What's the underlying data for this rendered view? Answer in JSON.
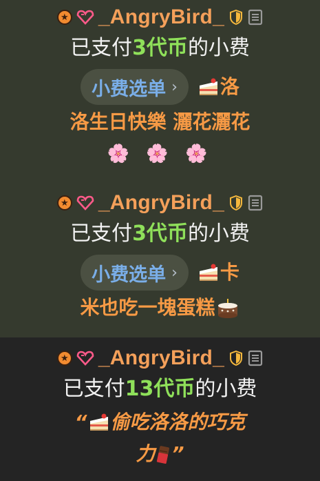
{
  "colors": {
    "card1_bg": "#353a2e",
    "card2_bg": "#242424",
    "username": "#f4a05a",
    "amount": "#8fe05a",
    "gift_text": "#f79a45",
    "menu_label": "#7aaee8"
  },
  "entries": [
    {
      "username": "_AngryBird_",
      "paid_prefix": "已支付",
      "amount": "3代币",
      "paid_suffix": "的小费",
      "menu_label": "小费选单",
      "menu_chevron": "›",
      "gift_icon": "cake-slice-icon",
      "gift_first": "洛",
      "gift_second": "洛生日快樂 灑花灑花",
      "gift_trailing": "🌸 🌸 🌸"
    },
    {
      "username": "_AngryBird_",
      "paid_prefix": "已支付",
      "amount": "3代币",
      "paid_suffix": "的小费",
      "menu_label": "小费选单",
      "menu_chevron": "›",
      "gift_icon": "cake-slice-icon",
      "gift_first": "卡",
      "gift_second": "米也吃一塊蛋糕",
      "gift_trailing_icon": "birthday-cake-icon"
    },
    {
      "username": "_AngryBird_",
      "paid_prefix": "已支付",
      "amount": "13代币",
      "paid_suffix": "的小费",
      "quote_open": "“",
      "quote_text1": "偷吃洛洛的巧克",
      "quote_text2": "力",
      "quote_close": "”",
      "quote_icons": [
        "cake-slice-icon",
        "chocolate-bar-icon"
      ]
    }
  ]
}
